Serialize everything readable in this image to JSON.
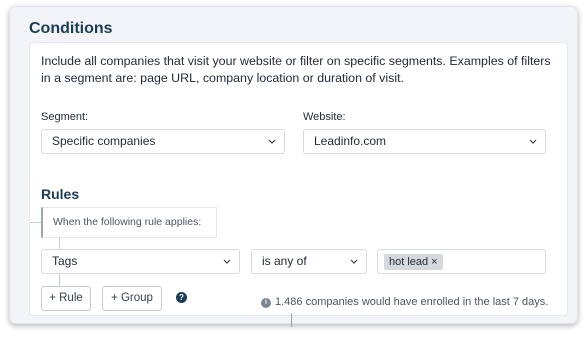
{
  "conditions": {
    "title": "Conditions",
    "description": "Include all companies that visit your website or filter on specific segments. Examples of filters in a segment are: page URL, company location or duration of visit.",
    "segment": {
      "label": "Segment:",
      "value": "Specific companies"
    },
    "website": {
      "label": "Website:",
      "value": "Leadinfo.com"
    }
  },
  "rules": {
    "title": "Rules",
    "applies_text": "When the following rule applies:",
    "rule": {
      "field": "Tags",
      "operator": "is any of",
      "values": [
        "hot lead"
      ],
      "remove_icon": "×"
    },
    "add_rule_label": "+ Rule",
    "add_group_label": "+ Group",
    "help_icon": "?",
    "info_icon": "i",
    "enrollment_info": "1.486 companies would have enrolled in the last 7 days."
  }
}
